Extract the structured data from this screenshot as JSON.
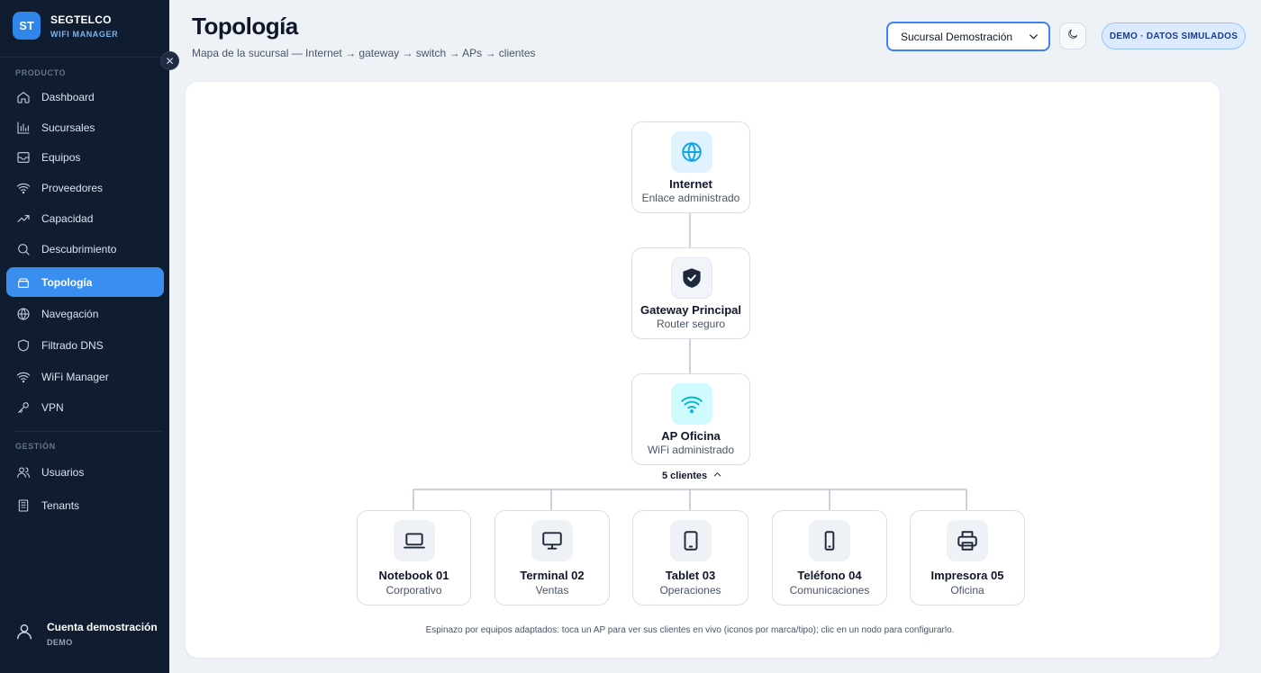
{
  "brand": {
    "logo": "ST",
    "name": "SEGTELCO",
    "subtitle": "WIFI MANAGER"
  },
  "sidebar": {
    "section_product": "PRODUCTO",
    "section_management": "GESTIÓN",
    "items": [
      {
        "label": "Dashboard",
        "icon": "home-icon"
      },
      {
        "label": "Sucursales",
        "icon": "bar-chart-icon"
      },
      {
        "label": "Equipos",
        "icon": "inbox-icon"
      },
      {
        "label": "Proveedores",
        "icon": "wifi-icon"
      },
      {
        "label": "Capacidad",
        "icon": "trend-up-icon"
      },
      {
        "label": "Descubrimiento",
        "icon": "search-icon"
      },
      {
        "label": "Topología",
        "icon": "layers-icon",
        "active": true
      },
      {
        "label": "Navegación",
        "icon": "globe-icon"
      },
      {
        "label": "Filtrado DNS",
        "icon": "shield-icon"
      },
      {
        "label": "WiFi Manager",
        "icon": "wifi-icon"
      },
      {
        "label": "VPN",
        "icon": "key-icon"
      }
    ],
    "management_items": [
      {
        "label": "Usuarios",
        "icon": "users-icon"
      },
      {
        "label": "Tenants",
        "icon": "building-icon"
      }
    ],
    "account": {
      "name": "Cuenta demostración",
      "role": "DEMO"
    }
  },
  "header": {
    "title": "Topología",
    "subtitle": "Mapa de la sucursal — Internet → gateway → switch → APs → clientes",
    "branch_select": "Sucursal Demostración",
    "demo_badge": "DEMO · DATOS SIMULADOS"
  },
  "topology": {
    "internet": {
      "title": "Internet",
      "subtitle": "Enlace administrado",
      "icon": "globe-icon"
    },
    "gateway": {
      "title": "Gateway Principal",
      "subtitle": "Router seguro",
      "icon": "shield-icon"
    },
    "ap": {
      "title": "AP Oficina",
      "subtitle": "WiFi administrado",
      "icon": "wifi-icon"
    },
    "clients_toggle": "5 clientes",
    "clients": [
      {
        "title": "Notebook 01",
        "subtitle": "Corporativo",
        "icon": "laptop-icon"
      },
      {
        "title": "Terminal 02",
        "subtitle": "Ventas",
        "icon": "monitor-icon"
      },
      {
        "title": "Tablet 03",
        "subtitle": "Operaciones",
        "icon": "tablet-icon"
      },
      {
        "title": "Teléfono 04",
        "subtitle": "Comunicaciones",
        "icon": "phone-icon"
      },
      {
        "title": "Impresora 05",
        "subtitle": "Oficina",
        "icon": "printer-icon"
      }
    ],
    "footnote": "Espinazo por equipos adaptados: toca un AP para ver sus clientes en vivo (iconos por marca/tipo); clic en un nodo para configurarlo."
  },
  "colors": {
    "sidebar_bg": "#101c30",
    "accent": "#3a8ef0",
    "badge_bg": "#dbeafe"
  }
}
